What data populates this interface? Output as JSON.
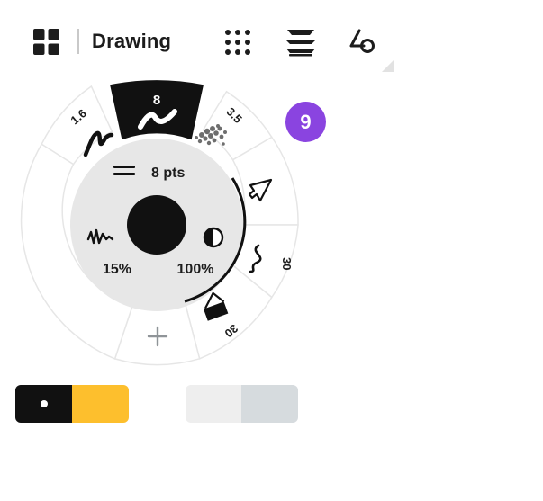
{
  "toolbar": {
    "title": "Drawing",
    "icons": [
      "grid-layout-icon",
      "dots-grid-icon",
      "layers-icon",
      "shapes-icon",
      "resize-corner-icon"
    ]
  },
  "badge": {
    "count": "9"
  },
  "wheel": {
    "tools": [
      {
        "name": "pen",
        "size": "1.6",
        "selected": false
      },
      {
        "name": "brush",
        "size": "8",
        "selected": true
      },
      {
        "name": "pencil",
        "size": "3.5",
        "selected": false
      },
      {
        "name": "selection-arrow",
        "size": "",
        "selected": false
      },
      {
        "name": "wire",
        "size": "30",
        "selected": false
      },
      {
        "name": "eraser",
        "size": "30",
        "selected": false
      },
      {
        "name": "add-tool",
        "size": "",
        "selected": false
      }
    ],
    "size_label": "8 pts",
    "smoothing": "15%",
    "opacity": "100%",
    "colors": {
      "brush": "#111111",
      "selected_tab": "#111111",
      "accent": "#8a44e0"
    }
  },
  "history": {
    "undo_icon": "undo-icon",
    "redo_icon": "redo-icon"
  },
  "palettes": [
    {
      "swatches": [
        "#111111",
        "#fdbf2d"
      ],
      "active_index": 0
    },
    {
      "swatches": [
        "#eeeeee",
        "#d6dbde"
      ],
      "active_index": -1
    }
  ]
}
